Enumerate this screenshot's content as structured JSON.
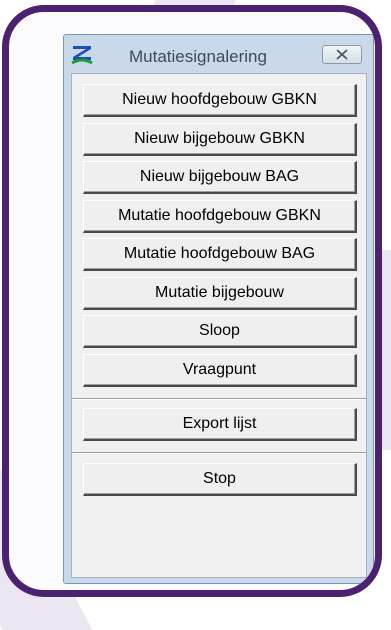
{
  "window": {
    "title": "Mutatiesignalering",
    "icon": "app-logo-icon",
    "close_icon": "close-icon"
  },
  "buttons": [
    {
      "id": "nieuw-hoofdgebouw-gbkn",
      "label": "Nieuw hoofdgebouw GBKN"
    },
    {
      "id": "nieuw-bijgebouw-gbkn",
      "label": "Nieuw bijgebouw GBKN"
    },
    {
      "id": "nieuw-bijgebouw-bag",
      "label": "Nieuw bijgebouw BAG"
    },
    {
      "id": "mutatie-hoofdgebouw-gbkn",
      "label": "Mutatie hoofdgebouw GBKN"
    },
    {
      "id": "mutatie-hoofdgebouw-bag",
      "label": "Mutatie hoofdgebouw BAG"
    },
    {
      "id": "mutatie-bijgebouw",
      "label": "Mutatie bijgebouw"
    },
    {
      "id": "sloop",
      "label": "Sloop"
    },
    {
      "id": "vraagpunt",
      "label": "Vraagpunt"
    }
  ],
  "export": {
    "label": "Export lijst"
  },
  "stop": {
    "label": "Stop"
  },
  "colors": {
    "frame": "#4b2270",
    "window_chrome": "#c9d9ea",
    "content_bg": "#f0f0f0",
    "icon_green": "#1a9a3a",
    "icon_blue": "#1f4fb4"
  }
}
